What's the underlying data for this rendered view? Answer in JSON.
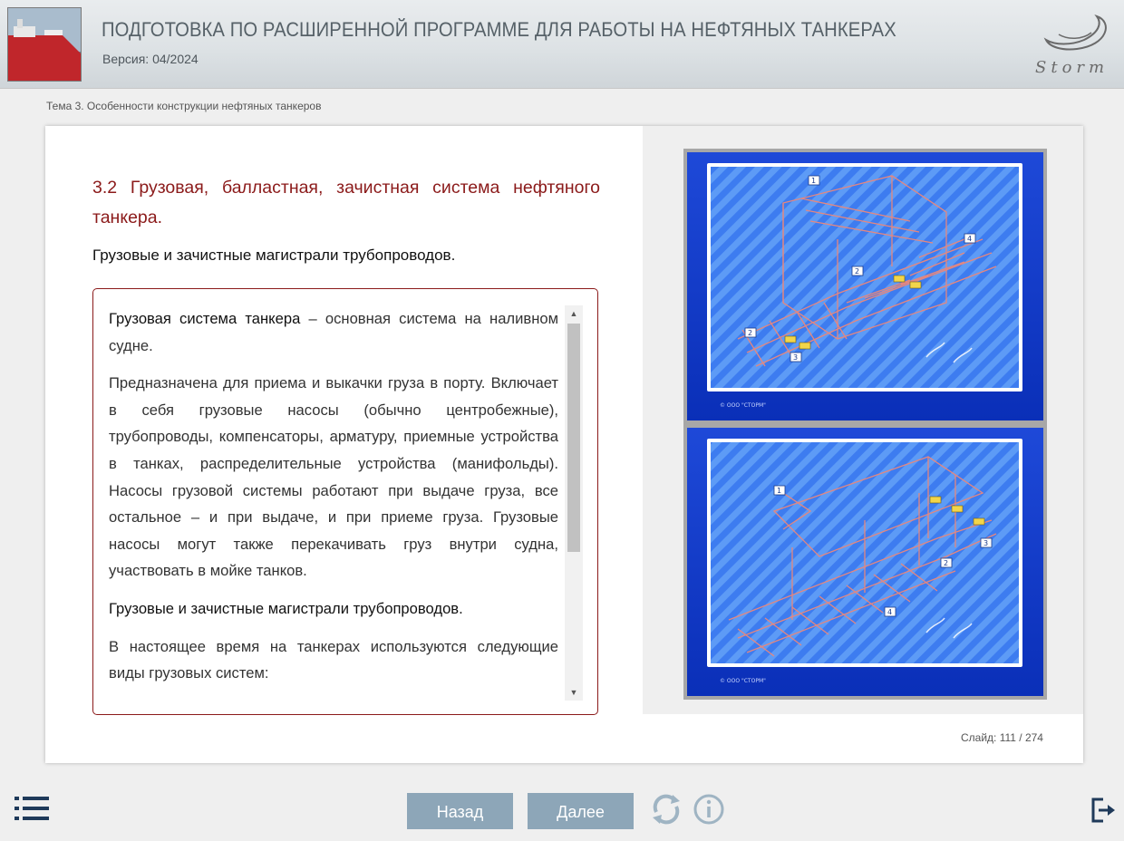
{
  "header": {
    "title": "ПОДГОТОВКА ПО РАСШИРЕННОЙ ПРОГРАММЕ ДЛЯ РАБОТЫ НА НЕФТЯНЫХ ТАНКЕРАХ",
    "version": "Версия: 04/2024",
    "logo_text": "Storm"
  },
  "breadcrumb": "Тема 3. Особенности конструкции нефтяных танкеров",
  "lesson": {
    "title": "3.2 Грузовая, балластная, зачистная система нефтяного танкера.",
    "subtitle": "Грузовые и зачистные магистрали трубопроводов.",
    "paragraphs": {
      "p1_bold": "Грузовая система танкера",
      "p1_rest": " – основная система на наливном судне.",
      "p2": "Предназначена для приема и выкачки груза в порту. Включает в себя грузовые насосы (обычно центробежные), трубопроводы, компенсаторы, арматуру, приемные устройства в танках, распределительные устройства (манифольды). Насосы грузовой системы работают при выдаче груза, все остальное – и при выдаче, и при приеме груза. Грузовые насосы могут также перекачивать груз внутри судна, участвовать в мойке танков.",
      "p3": "Грузовые и зачистные магистрали трубопроводов.",
      "p4": "В настоящее время на танкерах используются следующие виды грузовых систем:"
    }
  },
  "diagram": {
    "top_labels": [
      "1",
      "2",
      "4",
      "2",
      "3"
    ],
    "bottom_labels": [
      "1",
      "2",
      "3",
      "4"
    ],
    "copyright": "© ООО \"СТОРМ\""
  },
  "slide_counter": "Слайд: 111 / 274",
  "nav": {
    "back_label": "Назад",
    "next_label": "Далее"
  },
  "colors": {
    "accent": "#8b1a1a",
    "button": "#8da6b8",
    "icon": "#9fb4c3",
    "dark_icon": "#1f3a5a",
    "diagram_blue": "#1a4fe0"
  }
}
